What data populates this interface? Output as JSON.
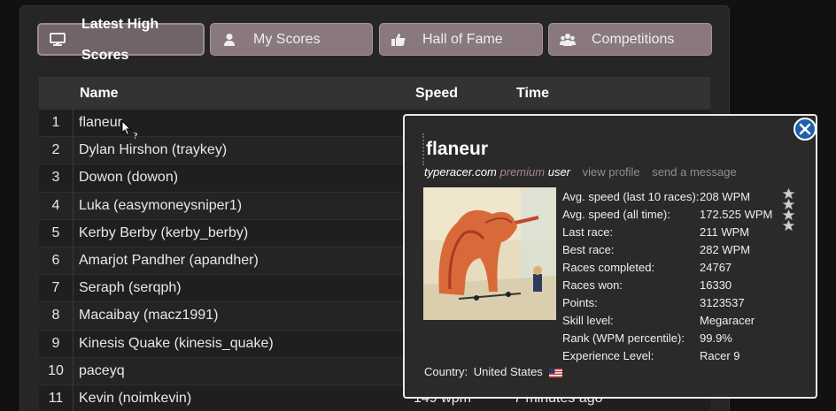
{
  "tabs": [
    {
      "label": "Latest High Scores",
      "icon": "monitor-icon",
      "active": true
    },
    {
      "label": "My Scores",
      "icon": "user-icon",
      "active": false
    },
    {
      "label": "Hall of Fame",
      "icon": "thumbs-up-icon",
      "active": false
    },
    {
      "label": "Competitions",
      "icon": "group-icon",
      "active": false
    }
  ],
  "table": {
    "headers": {
      "name": "Name",
      "speed": "Speed",
      "time": "Time"
    },
    "rows": [
      {
        "rank": "1",
        "name": "flaneur",
        "speed": "",
        "time": ""
      },
      {
        "rank": "2",
        "name": "Dylan Hirshon (traykey)",
        "speed": "",
        "time": ""
      },
      {
        "rank": "3",
        "name": "Dowon (dowon)",
        "speed": "",
        "time": ""
      },
      {
        "rank": "4",
        "name": "Luka (easymoneysniper1)",
        "speed": "",
        "time": ""
      },
      {
        "rank": "5",
        "name": "Kerby Berby (kerby_berby)",
        "speed": "",
        "time": ""
      },
      {
        "rank": "6",
        "name": "Amarjot Pandher (apandher)",
        "speed": "",
        "time": ""
      },
      {
        "rank": "7",
        "name": "Seraph (serqph)",
        "speed": "",
        "time": ""
      },
      {
        "rank": "8",
        "name": "Macaibay (macz1991)",
        "speed": "",
        "time": ""
      },
      {
        "rank": "9",
        "name": "Kinesis Quake (kinesis_quake)",
        "speed": "",
        "time": ""
      },
      {
        "rank": "10",
        "name": "paceyq",
        "speed": "",
        "time": ""
      },
      {
        "rank": "11",
        "name": "Kevin (noimkevin)",
        "speed": "149 wpm",
        "time": "7 minutes ago"
      }
    ]
  },
  "popup": {
    "username": "flaneur",
    "site": "typeracer.com",
    "account_type": "premium",
    "account_suffix": "user",
    "view_profile": "view profile",
    "send_message": "send a message",
    "stats": [
      {
        "label": "Avg. speed (last 10 races):",
        "value": "208 WPM"
      },
      {
        "label": "Avg. speed (all time):",
        "value": "172.525 WPM"
      },
      {
        "label": "Last race:",
        "value": "211 WPM"
      },
      {
        "label": "Best race:",
        "value": "282 WPM"
      },
      {
        "label": "Races completed:",
        "value": "24767"
      },
      {
        "label": "Races won:",
        "value": "16330"
      },
      {
        "label": "Points:",
        "value": "3123537"
      },
      {
        "label": "Skill level:",
        "value": "Megaracer"
      },
      {
        "label": "Rank (WPM percentile):",
        "value": "99.9%"
      },
      {
        "label": "Experience Level:",
        "value": "Racer 9"
      }
    ],
    "stars": 4,
    "country_label": "Country:",
    "country_value": "United States",
    "country_flag": "us-flag-icon"
  },
  "colors": {
    "tab_bg": "#8a7880",
    "tab_active_bg": "#70636a",
    "close_button": "#1e5fa8",
    "premium_text": "#a08a96"
  }
}
